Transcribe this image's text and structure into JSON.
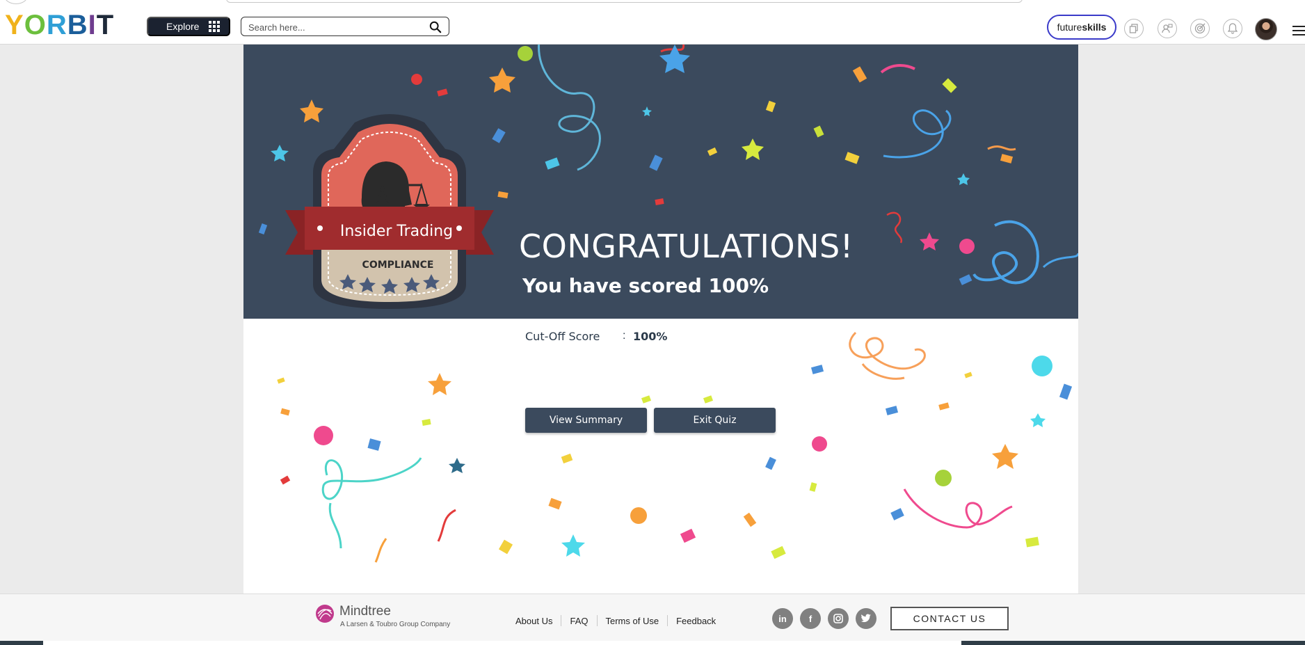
{
  "header": {
    "logo_letters": [
      {
        "char": "Y",
        "color": "#f0b21b"
      },
      {
        "char": "O",
        "color": "#6cbf3d"
      },
      {
        "char": "R",
        "color": "#2f9fd6"
      },
      {
        "char": "B",
        "color": "#1b5e9a"
      },
      {
        "char": "I",
        "color": "#6f3d8f"
      },
      {
        "char": "T",
        "color": "#1f2a3a"
      }
    ],
    "explore_label": "Explore",
    "search_placeholder": "Search here...",
    "future_skills": {
      "part1": "future",
      "part2": "skills"
    },
    "icons": [
      "copy-icon",
      "user-chat-icon",
      "target-icon",
      "bell-icon"
    ]
  },
  "hero": {
    "badge_title": "Insider Trading",
    "badge_subtitle": "COMPLIANCE",
    "heading": "CONGRATULATIONS!",
    "score_text": "You have scored 100%"
  },
  "result": {
    "cutoff_label": "Cut-Off Score",
    "cutoff_separator": ":",
    "cutoff_value": "100%"
  },
  "actions": {
    "view_summary": "View Summary",
    "exit_quiz": "Exit Quiz"
  },
  "footer": {
    "brand": "Mindtree",
    "tagline": "A Larsen & Toubro Group Company",
    "links": [
      "About Us",
      "FAQ",
      "Terms of Use",
      "Feedback"
    ],
    "social": [
      "in",
      "f",
      "ig",
      "tw"
    ],
    "contact_label": "CONTACT US"
  },
  "colors": {
    "hero_bg": "#3b4a5d",
    "button_bg": "#3b4a5d",
    "accent_purple": "#3a3ac9"
  }
}
